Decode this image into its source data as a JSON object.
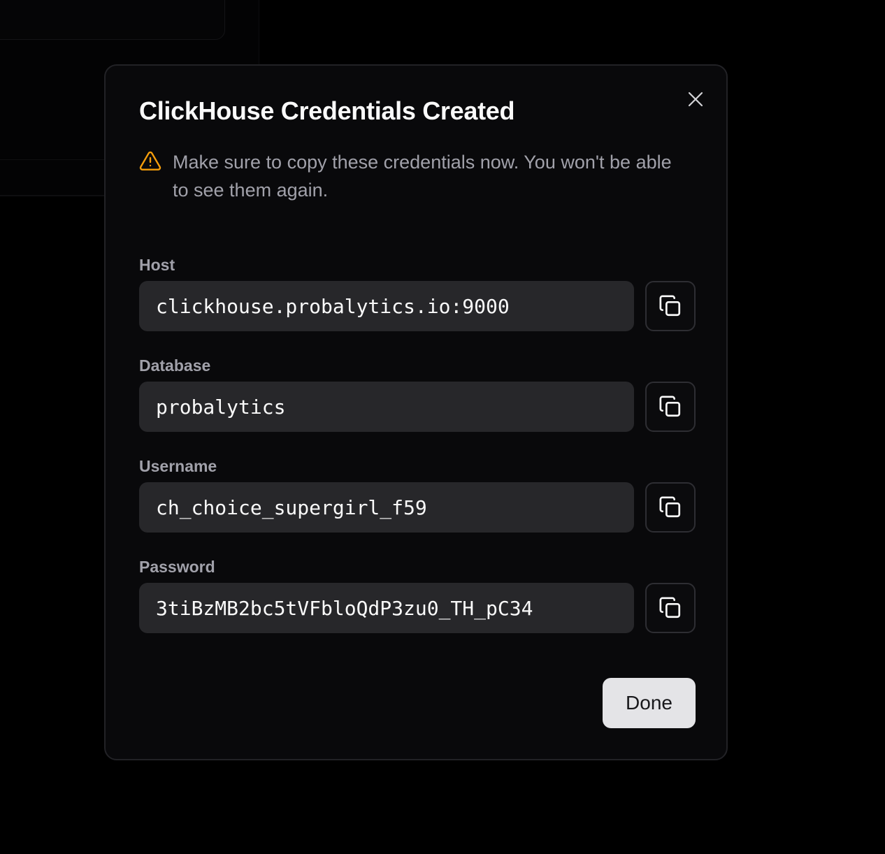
{
  "dialog": {
    "title": "ClickHouse Credentials Created",
    "warning": "Make sure to copy these credentials now. You won't be able to see them again.",
    "close_icon": "x-icon",
    "warning_icon": "alert-triangle-icon",
    "copy_icon": "copy-icon",
    "done_label": "Done"
  },
  "fields": [
    {
      "label": "Host",
      "value": "clickhouse.probalytics.io:9000"
    },
    {
      "label": "Database",
      "value": "probalytics"
    },
    {
      "label": "Username",
      "value": "ch_choice_supergirl_f59"
    },
    {
      "label": "Password",
      "value": "3tiBzMB2bc5tVFbloQdP3zu0_TH_pC34"
    }
  ],
  "colors": {
    "background": "#000000",
    "dialog_bg": "#09090b",
    "field_bg": "#27272a",
    "warning": "#f59e0b",
    "primary_button": "#e4e4e7"
  }
}
